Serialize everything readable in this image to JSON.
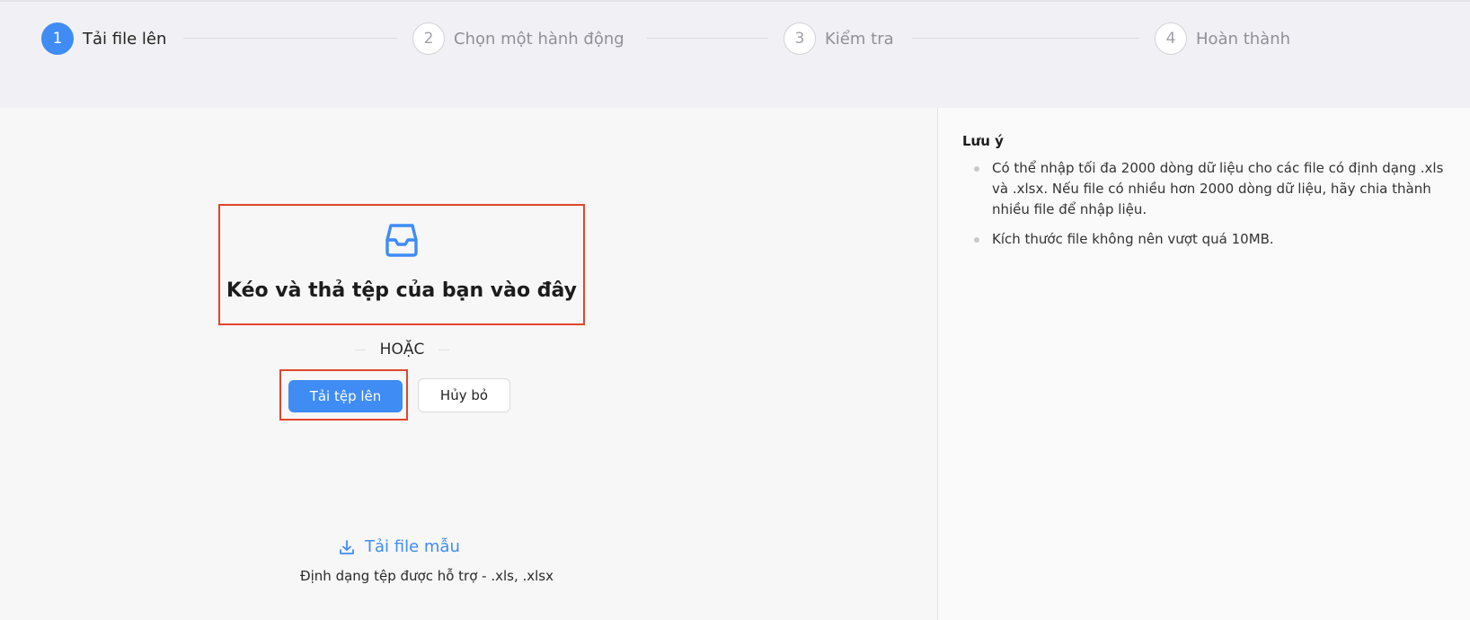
{
  "steps": [
    {
      "number": "1",
      "label": "Tải file lên",
      "active": true
    },
    {
      "number": "2",
      "label": "Chọn một hành động",
      "active": false
    },
    {
      "number": "3",
      "label": "Kiểm tra",
      "active": false
    },
    {
      "number": "4",
      "label": "Hoàn thành",
      "active": false
    }
  ],
  "upload": {
    "icon": "inbox-icon",
    "drop_text": "Kéo và thả tệp của bạn vào đây",
    "or_text": "HOẶC",
    "upload_button": "Tải tệp lên",
    "cancel_button": "Hủy bỏ",
    "template_icon": "download-icon",
    "template_link": "Tải file mẫu",
    "formats_text": "Định dạng tệp được hỗ trợ - .xls, .xlsx"
  },
  "notes": {
    "title": "Lưu ý",
    "items": [
      "Có thể nhập tối đa 2000 dòng dữ liệu cho các file có định dạng .xls và .xlsx. Nếu file có nhiều hơn 2000 dòng dữ liệu, hãy chia thành nhiều file để nhập liệu.",
      "Kích thước file không nên vượt quá 10MB."
    ]
  },
  "colors": {
    "accent": "#3f8cf5",
    "highlight_border": "#e0452c"
  }
}
